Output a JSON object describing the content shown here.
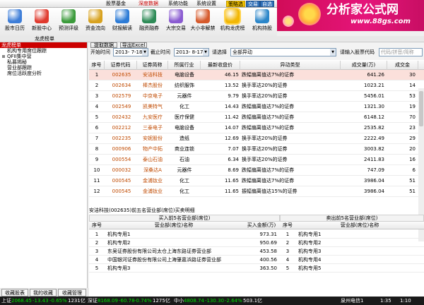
{
  "menu": {
    "items": [
      "股票基金",
      "深度数据",
      "系统功能",
      "系统设置"
    ],
    "active_index": 1,
    "modes": [
      "策略选",
      "交易",
      "自选"
    ],
    "active_mode_index": 0
  },
  "brand": {
    "title": "分析家公式网",
    "url": "www.88gs.com"
  },
  "toolbar": [
    {
      "label": "股市日历",
      "icon": "calendar-icon",
      "color": "#3d7dd8"
    },
    {
      "label": "新股中心",
      "icon": "new-stock-icon",
      "color": "#e03a2e"
    },
    {
      "label": "预测评级",
      "icon": "rating-icon",
      "color": "#3b9b3b"
    },
    {
      "label": "资金流向",
      "icon": "money-flow-icon",
      "color": "#d8a21f"
    },
    {
      "label": "财报解读",
      "icon": "report-icon",
      "color": "#2c7bd6"
    },
    {
      "label": "融资融券",
      "icon": "margin-icon",
      "color": "#2e8b57"
    },
    {
      "label": "大宗交易",
      "icon": "block-trade-icon",
      "color": "#8a5bd1"
    },
    {
      "label": "大小非解禁",
      "icon": "unlock-icon",
      "color": "#d65a2c"
    },
    {
      "label": "机构龙虎榜",
      "icon": "dragon-tiger-icon",
      "color": "#f2b705",
      "selected": true
    },
    {
      "label": "机构持股",
      "icon": "holding-icon",
      "color": "#2b86c9"
    }
  ],
  "panel_title": "龙虎榜单",
  "tree": [
    {
      "label": "龙虎榜单",
      "selected": true
    },
    {
      "label": "机构专用席位跟踪"
    },
    {
      "label": "QFII集中营"
    },
    {
      "label": "私募揭秘"
    },
    {
      "label": "营业部跟踪"
    },
    {
      "label": "席位活跃度分析"
    }
  ],
  "left_tabs": [
    "收藏股表",
    "我的收藏",
    "收藏管理"
  ],
  "filter": {
    "start_label": "开始时间",
    "start_value": "2013- 7-18",
    "end_label": "截止时间",
    "end_value": "2013- 8-17",
    "type_label": "请选择",
    "type_value": "全部异动",
    "code_label": "请输入股票代码",
    "code_placeholder": "代码/拼音/简称",
    "btn_fetch": "提取数据",
    "btn_export": "导出Excel"
  },
  "grid": {
    "headers": [
      "序号",
      "证券代码",
      "证券简称",
      "所属行业",
      "最新收盘价",
      "异动类型",
      "成交量(万)",
      "成交金"
    ],
    "rows": [
      [
        "1",
        "002635",
        "安洁科技",
        "电脑设备",
        "46.15",
        "跌幅偏离值达7%的证券",
        "641.26",
        "30"
      ],
      [
        "2",
        "002634",
        "棒杰股份",
        "纺织服饰",
        "13.52",
        "换手率达20%的证券",
        "1023.21",
        "14"
      ],
      [
        "3",
        "002579",
        "中京电子",
        "元器件",
        "9.79",
        "换手率达20%的证券",
        "5456.01",
        "53"
      ],
      [
        "4",
        "002549",
        "凯美特气",
        "化工",
        "14.43",
        "跌幅偏离值达7%的证券",
        "1321.30",
        "19"
      ],
      [
        "5",
        "002432",
        "九安医疗",
        "医疗保健",
        "11.42",
        "跌幅偏离值达7%的证券",
        "6148.12",
        "70"
      ],
      [
        "6",
        "002212",
        "三泰电子",
        "电脑设备",
        "14.07",
        "跌幅偏离值达7%的证券",
        "2535.82",
        "23"
      ],
      [
        "7",
        "002235",
        "安妮股份",
        "造纸",
        "12.69",
        "换手率达20%的证券",
        "2222.49",
        "29"
      ],
      [
        "8",
        "000906",
        "物产中拓",
        "商业连锁",
        "7.07",
        "换手率达20%的证券",
        "3003.82",
        "20"
      ],
      [
        "9",
        "000554",
        "泰山石油",
        "石油",
        "6.34",
        "换手率达20%的证券",
        "2411.83",
        "16"
      ],
      [
        "10",
        "000032",
        "深桑达A",
        "元器件",
        "8.69",
        "跌幅偏离值达7%的证券",
        "747.09",
        "6"
      ],
      [
        "11",
        "000545",
        "金浦钛业",
        "化工",
        "11.65",
        "跌幅偏离值达7%的证券",
        "3986.04",
        "51"
      ],
      [
        "12",
        "000545",
        "金浦钛业",
        "化工",
        "11.65",
        "振幅偏离值达15%的证券",
        "3986.04",
        "51"
      ]
    ],
    "selected_index": 0
  },
  "detail": {
    "title": "安洁科技(002635)前五名营业部(席位)买卖明细",
    "buy_title": "买入前5名营业部(席位)",
    "sell_title": "卖出前5名营业部(席位)",
    "buy_headers": [
      "序号",
      "营业部(席位)名称",
      "买入金额(万)"
    ],
    "sell_headers": [
      "序号",
      "营业部(席位)名称"
    ],
    "buy_rows": [
      [
        "1",
        "机构专用1",
        "973.31"
      ],
      [
        "2",
        "机构专用2",
        "950.69"
      ],
      [
        "3",
        "东吴证券股份有限公司太仓上海东路证券营业部",
        "453.58"
      ],
      [
        "4",
        "中国银河证券股份有限公司上海肇嘉浜路证券营业部",
        "400.56"
      ],
      [
        "5",
        "机构专用3",
        "363.50"
      ]
    ],
    "sell_rows": [
      [
        "1",
        "机构专用1"
      ],
      [
        "2",
        "机构专用2"
      ],
      [
        "3",
        "机构专用3"
      ],
      [
        "4",
        "机构专用4"
      ],
      [
        "5",
        "机构专用5"
      ]
    ]
  },
  "status": {
    "sh_label": "上证",
    "sh_value": "2068.45",
    "sh_change": "-13.43",
    "sh_pct": "-0.65%",
    "sh_vol": "1231亿",
    "sz_label": "深证",
    "sz_value": "8168.09",
    "sz_change": "-60.78",
    "sz_pct": "-0.74%",
    "sz_vol": "1275亿",
    "mid_label": "中小",
    "mid_value": "4808.74",
    "mid_change": "-130.30",
    "mid_pct": "-2.64%",
    "mid_vol": "503.1亿",
    "server": "泉州电信1",
    "time": "1:35",
    "extra": "1:10"
  },
  "colors": {
    "accent_red": "#cc0000",
    "code_orange": "#c04a00",
    "brand_pink": "#e5157a",
    "down_green": "#00e000"
  }
}
